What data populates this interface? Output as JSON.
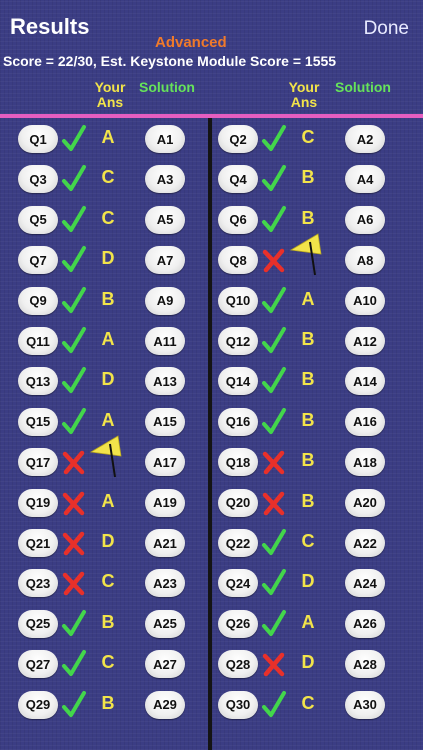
{
  "header": {
    "title": "Results",
    "done_label": "Done",
    "level": "Advanced",
    "score_text": "Score = 22/30, Est. Keystone Module Score = 1555",
    "your_ans_line1": "Your",
    "your_ans_line2": "Ans",
    "solution_label": "Solution"
  },
  "colors": {
    "correct": "#43d64b",
    "wrong": "#e8302a",
    "answer": "#f2e44a",
    "level": "#f07a2a",
    "accent_line": "#e55ec0"
  },
  "questions": [
    {
      "q": "Q1",
      "status": "correct",
      "ans": "A",
      "sol": "A1"
    },
    {
      "q": "Q2",
      "status": "correct",
      "ans": "C",
      "sol": "A2"
    },
    {
      "q": "Q3",
      "status": "correct",
      "ans": "C",
      "sol": "A3"
    },
    {
      "q": "Q4",
      "status": "correct",
      "ans": "B",
      "sol": "A4"
    },
    {
      "q": "Q5",
      "status": "correct",
      "ans": "C",
      "sol": "A5"
    },
    {
      "q": "Q6",
      "status": "correct",
      "ans": "B",
      "sol": "A6"
    },
    {
      "q": "Q7",
      "status": "correct",
      "ans": "D",
      "sol": "A7"
    },
    {
      "q": "Q8",
      "status": "wrong",
      "ans": "",
      "flag": true,
      "sol": "A8"
    },
    {
      "q": "Q9",
      "status": "correct",
      "ans": "B",
      "sol": "A9"
    },
    {
      "q": "Q10",
      "status": "correct",
      "ans": "A",
      "sol": "A10"
    },
    {
      "q": "Q11",
      "status": "correct",
      "ans": "A",
      "sol": "A11"
    },
    {
      "q": "Q12",
      "status": "correct",
      "ans": "B",
      "sol": "A12"
    },
    {
      "q": "Q13",
      "status": "correct",
      "ans": "D",
      "sol": "A13"
    },
    {
      "q": "Q14",
      "status": "correct",
      "ans": "B",
      "sol": "A14"
    },
    {
      "q": "Q15",
      "status": "correct",
      "ans": "A",
      "sol": "A15"
    },
    {
      "q": "Q16",
      "status": "correct",
      "ans": "B",
      "sol": "A16"
    },
    {
      "q": "Q17",
      "status": "wrong",
      "ans": "",
      "flag": true,
      "sol": "A17"
    },
    {
      "q": "Q18",
      "status": "wrong",
      "ans": "B",
      "sol": "A18"
    },
    {
      "q": "Q19",
      "status": "wrong",
      "ans": "A",
      "sol": "A19"
    },
    {
      "q": "Q20",
      "status": "wrong",
      "ans": "B",
      "sol": "A20"
    },
    {
      "q": "Q21",
      "status": "wrong",
      "ans": "D",
      "sol": "A21"
    },
    {
      "q": "Q22",
      "status": "correct",
      "ans": "C",
      "sol": "A22"
    },
    {
      "q": "Q23",
      "status": "wrong",
      "ans": "C",
      "sol": "A23"
    },
    {
      "q": "Q24",
      "status": "correct",
      "ans": "D",
      "sol": "A24"
    },
    {
      "q": "Q25",
      "status": "correct",
      "ans": "B",
      "sol": "A25"
    },
    {
      "q": "Q26",
      "status": "correct",
      "ans": "A",
      "sol": "A26"
    },
    {
      "q": "Q27",
      "status": "correct",
      "ans": "C",
      "sol": "A27"
    },
    {
      "q": "Q28",
      "status": "wrong",
      "ans": "D",
      "sol": "A28"
    },
    {
      "q": "Q29",
      "status": "correct",
      "ans": "B",
      "sol": "A29"
    },
    {
      "q": "Q30",
      "status": "correct",
      "ans": "C",
      "sol": "A30"
    }
  ]
}
